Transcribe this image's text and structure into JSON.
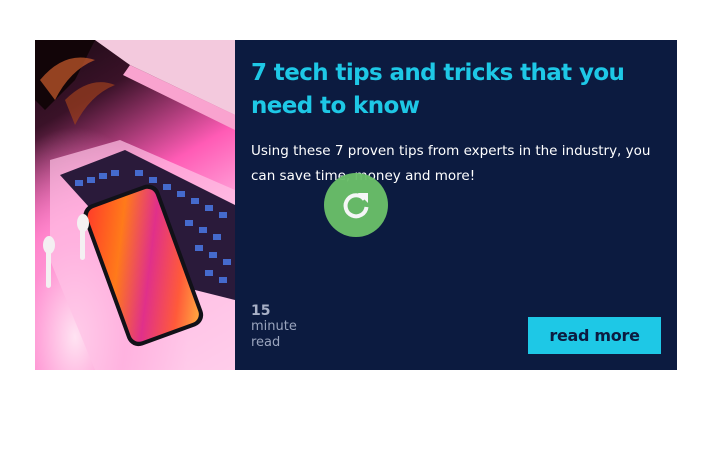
{
  "card": {
    "title": "7 tech tips and tricks that you need to know",
    "description": "Using these 7 proven tips from experts in the industry, you can save time, money and more!",
    "reading_time": {
      "value": "15",
      "unit_line1": "minute",
      "unit_line2": "read"
    },
    "cta_label": "read more",
    "image_subject": "laptop-and-phone-photo"
  },
  "overlay": {
    "icon": "refresh-icon"
  },
  "colors": {
    "card_background": "#0c1b40",
    "accent": "#1ec8e6",
    "overlay_green": "#6abf69",
    "text_white": "#ffffff",
    "muted_text": "#9aa4bd"
  }
}
